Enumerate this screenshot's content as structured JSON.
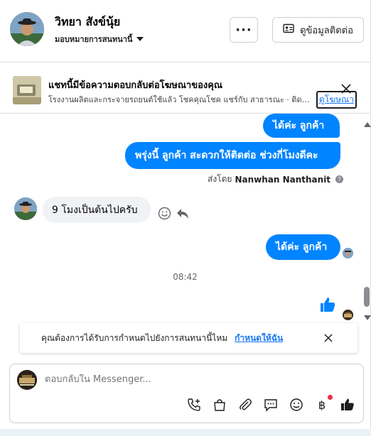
{
  "header": {
    "contact_name": "วิทยา สังข์นุ้ย",
    "assign_label": "มอบหมายการสนทนานี้",
    "more_label": "···",
    "info_label": "ดูข้อมูลติดต่อ"
  },
  "ad_banner": {
    "title": "แชทนี้มีข้อความตอบกลับต่อโฆษณาของคุณ",
    "subtitle": "โรงงานผลิตและกระจายรถยนต์ใช้แล้ว โชคคุณโชค แชร์กับ สาธารณะ · ติดต่อ...",
    "view_ad_label": "ดูโฆษณา"
  },
  "messages": {
    "out_1": "ได้ค่ะ  ลูกค้า",
    "out_2": "พรุ่งนี้ ลูกค้า  สะดวกให้ติดต่อ ช่วงกี่โมงดีคะ",
    "sent_by_prefix": "ส่งโดย",
    "sent_by_name": "Nanwhan Nanthanit",
    "in_1": "9 โมงเป็นต้นไปครับ",
    "out_3": "ได้ค่ะ  ลูกค้า",
    "timestamp": "08:42"
  },
  "reminder": {
    "text": "คุณต้องการได้รับการกำหนดไปยังการสนทนานี้ไหม",
    "link": "กำหนดให้ฉัน"
  },
  "composer": {
    "placeholder": "ตอบกลับใน Messenger...",
    "tools": [
      "call-add-icon",
      "shopping-bag-icon",
      "paperclip-icon",
      "saved-reply-icon",
      "emoji-icon",
      "payment-icon",
      "like-icon"
    ]
  },
  "colors": {
    "bubble_out": "#0084ff",
    "bubble_in": "#f0f2f5",
    "link": "#1877f2"
  }
}
